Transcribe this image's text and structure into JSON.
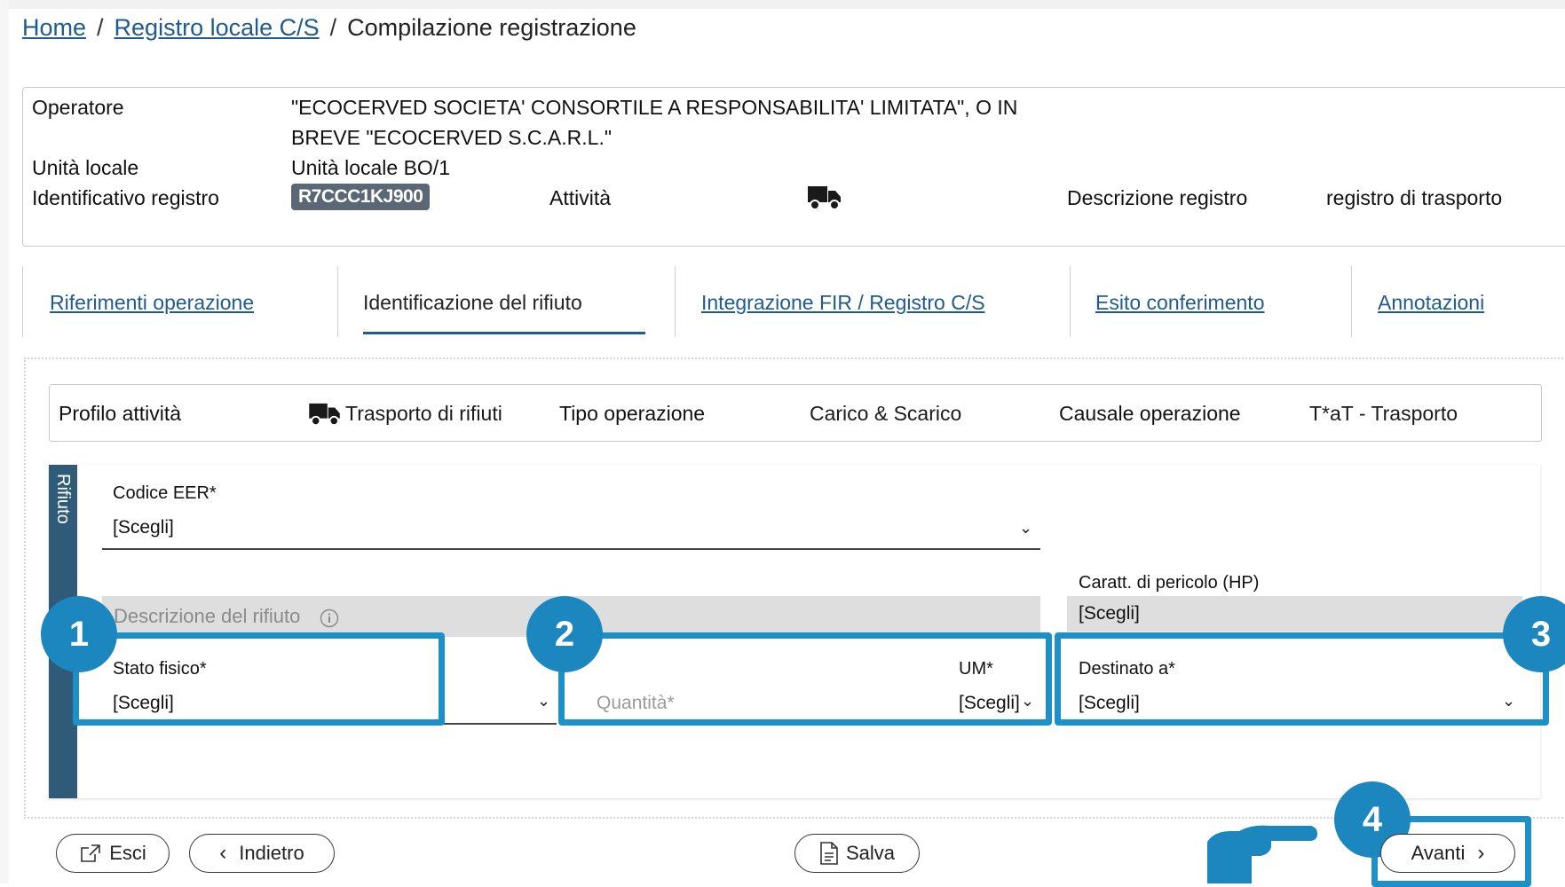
{
  "breadcrumb": {
    "home": "Home",
    "registro": "Registro locale C/S",
    "current": "Compilazione registrazione",
    "separator": "/"
  },
  "header": {
    "operatore_label": "Operatore",
    "operatore_line1": "\"ECOCERVED SOCIETA' CONSORTILE A RESPONSABILITA' LIMITATA\", O IN",
    "operatore_line2": "BREVE \"ECOCERVED S.C.A.R.L.\"",
    "unita_label": "Unità locale",
    "unita_value": "Unità locale BO/1",
    "id_label": "Identificativo registro",
    "id_value": "R7CCC1KJ900",
    "attivita_label": "Attività",
    "attivita_icon": "truck-icon",
    "descr_label": "Descrizione registro",
    "descr_value": "registro di trasporto"
  },
  "tabs": [
    {
      "label": "Riferimenti operazione",
      "active": false
    },
    {
      "label": "Identificazione del rifiuto",
      "active": true
    },
    {
      "label": "Integrazione FIR / Registro C/S",
      "active": false
    },
    {
      "label": "Esito conferimento",
      "active": false
    },
    {
      "label": "Annotazioni",
      "active": false
    }
  ],
  "profile": {
    "profilo_label": "Profilo attività",
    "profilo_value": "Trasporto di rifiuti",
    "tipo_label": "Tipo operazione",
    "tipo_value": "Carico & Scarico",
    "causale_label": "Causale operazione",
    "causale_value": "T*aT - Trasporto"
  },
  "rifiuto": {
    "section_label": "Rifiuto",
    "codice_label": "Codice EER*",
    "codice_value": "[Scegli]",
    "descrizione_placeholder": "Descrizione del rifiuto",
    "hp_label": "Caratt. di pericolo (HP)",
    "hp_value": "[Scegli]",
    "stato_label": "Stato fisico*",
    "stato_value": "[Scegli]",
    "quantita_placeholder": "Quantità*",
    "um_label": "UM*",
    "um_value": "[Scegli]",
    "destinato_label": "Destinato a*",
    "destinato_value": "[Scegli]"
  },
  "markers": [
    "1",
    "2",
    "3",
    "4"
  ],
  "buttons": {
    "esci": "Esci",
    "indietro": "Indietro",
    "salva": "Salva",
    "avanti": "Avanti"
  },
  "colors": {
    "link": "#1f5b8c",
    "highlight": "#1e90c8",
    "marker": "#1b87be",
    "section_bar": "#2f5b78",
    "badge": "#5a6775"
  }
}
